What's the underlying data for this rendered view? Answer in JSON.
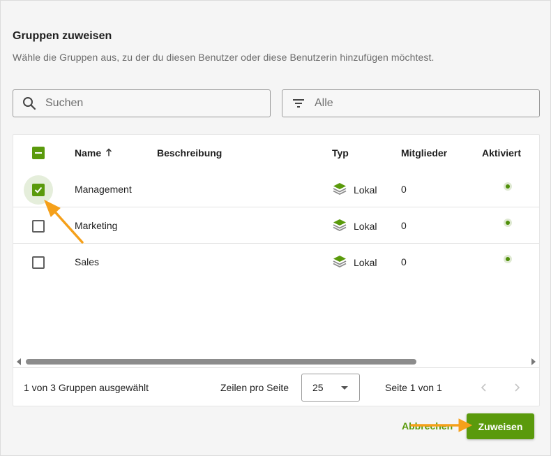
{
  "dialog": {
    "title": "Gruppen zuweisen",
    "subtitle": "Wähle die Gruppen aus, zu der du diesen Benutzer oder diese Benutzerin hinzufügen möchtest."
  },
  "search": {
    "placeholder": "Suchen",
    "icon": "search-icon"
  },
  "filter": {
    "value": "Alle",
    "icon": "filter-icon"
  },
  "table": {
    "columns": [
      "Name",
      "Beschreibung",
      "Typ",
      "Mitglieder",
      "Aktiviert"
    ],
    "sort": {
      "column": "Name",
      "direction": "ascending"
    },
    "select_all_state": "indeterminate",
    "rows": [
      {
        "name": "Management",
        "description": "",
        "type": "Lokal",
        "members": "0",
        "active": true,
        "selected": true
      },
      {
        "name": "Marketing",
        "description": "",
        "type": "Lokal",
        "members": "0",
        "active": true,
        "selected": false
      },
      {
        "name": "Sales",
        "description": "",
        "type": "Lokal",
        "members": "0",
        "active": true,
        "selected": false
      }
    ]
  },
  "footer": {
    "selection_text": "1 von 3 Gruppen ausgewählt",
    "rows_per_page_label": "Zeilen pro Seite",
    "rows_per_page_value": "25",
    "page_text": "Seite 1 von 1"
  },
  "actions": {
    "cancel_label": "Abbrechen",
    "assign_label": "Zuweisen"
  },
  "colors": {
    "accent": "#5a9a0c",
    "annotation": "#f5a01a"
  }
}
